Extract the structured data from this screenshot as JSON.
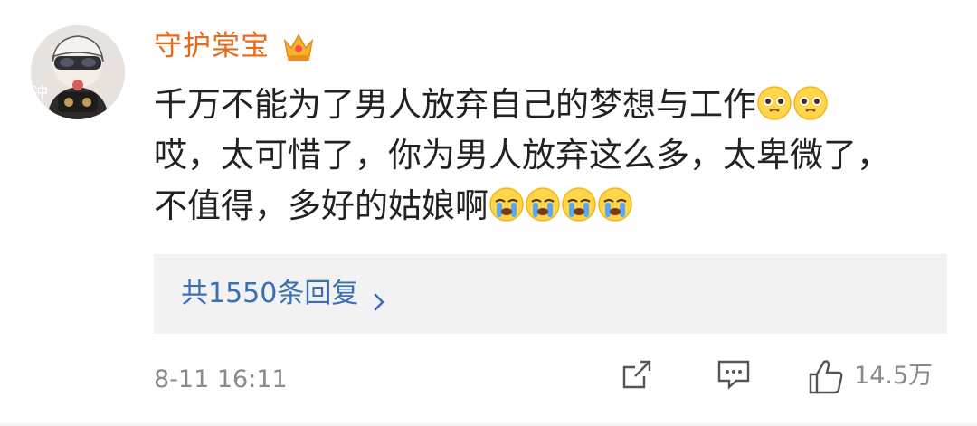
{
  "comment": {
    "username": "守护棠宝",
    "text_lines": [
      "千万不能为了男人放弃自己的梦想与工作",
      "哎，太可惜了，你为男人放弃这么多，太卑微了，",
      "不值得，多好的姑娘啊"
    ],
    "replies_label": "共1550条回复",
    "timestamp": "8-11 16:11",
    "like_count": "14.5万"
  },
  "avatar": {
    "corner_text": "冲"
  },
  "colors": {
    "username": "#e86a1c",
    "link": "#3b6fb5",
    "muted": "#8a8a8a",
    "reply_bg": "#f2f2f2"
  },
  "icons": {
    "vip": "crown-badge-icon",
    "sad_emoji": "pleading-face-icon",
    "cry_emoji": "crying-face-icon",
    "chevron": "chevron-right-icon",
    "share": "share-icon",
    "comment": "comment-icon",
    "like": "thumbs-up-icon"
  }
}
